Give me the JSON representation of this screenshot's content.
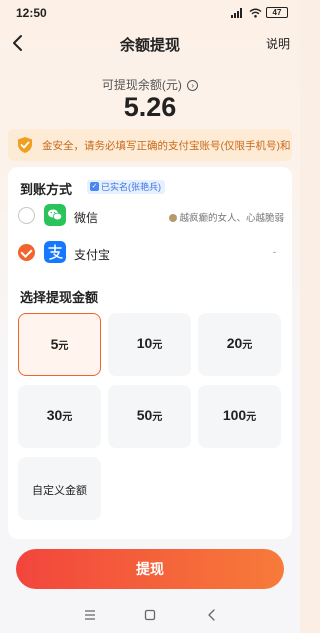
{
  "status_bar": {
    "time": "12:50",
    "battery": "47"
  },
  "header": {
    "title": "余额提现",
    "help_label": "说明"
  },
  "balance": {
    "label": "可提现余额(元)",
    "amount": "5.26"
  },
  "warning": {
    "text": "金安全，请务必填写正确的支付宝账号(仅限手机号)和"
  },
  "payment": {
    "section_title": "到账方式",
    "verified_badge": "已实名(张艳兵)",
    "methods": [
      {
        "name": "微信",
        "account": "越疯癫的女人、心越脆弱",
        "selected": false,
        "icon": "wechat-icon",
        "color": "#2bc45a"
      },
      {
        "name": "支付宝",
        "account": "-",
        "selected": true,
        "icon": "alipay-icon",
        "color": "#1677ff"
      }
    ]
  },
  "amounts": {
    "section_title": "选择提现金额",
    "unit": "元",
    "options": [
      "5",
      "10",
      "20",
      "30",
      "50",
      "100"
    ],
    "selected_index": 0,
    "custom_label": "自定义金额"
  },
  "withdraw_button": "提现",
  "colors": {
    "accent": "#f2642c",
    "button_start": "#f2453d",
    "button_end": "#f77b3a",
    "warning_text": "#c86a1c",
    "warning_bg": "#fdebd6"
  }
}
